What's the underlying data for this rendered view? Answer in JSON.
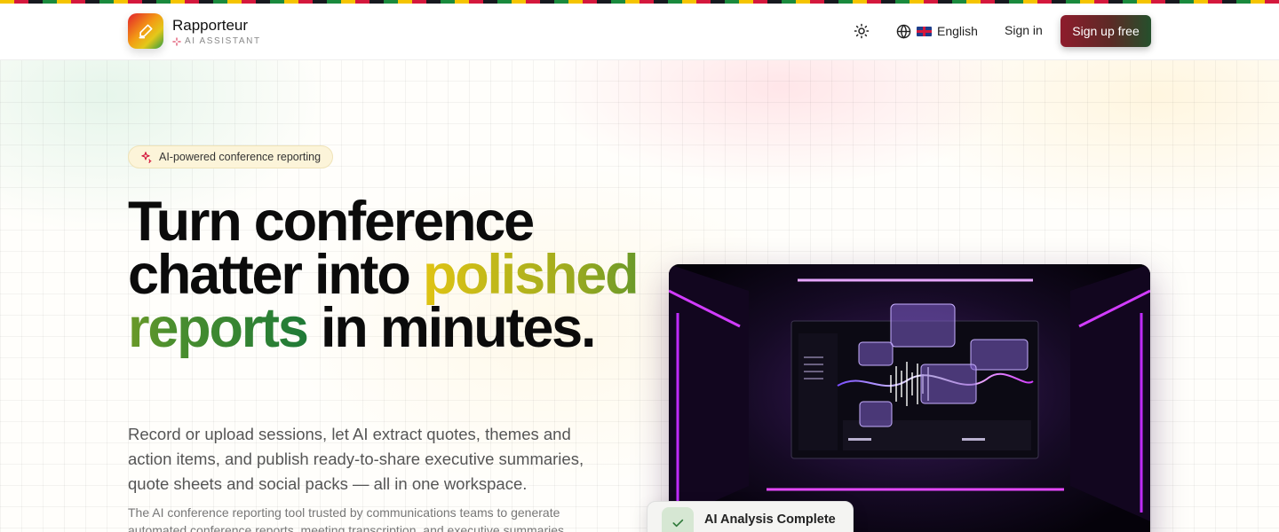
{
  "brand": {
    "name": "Rapporteur",
    "subtitle": "AI ASSISTANT",
    "logo_icon": "pen-icon"
  },
  "nav": {
    "theme_icon": "sun-icon",
    "language_icon": "globe-icon",
    "language_flag": "uk-flag-icon",
    "language_label": "English",
    "signin_label": "Sign in",
    "signup_label": "Sign up free"
  },
  "hero": {
    "pill_icon": "sparkles-icon",
    "pill_text": "AI-powered conference reporting",
    "headline_part1": "Turn conference chatter into ",
    "headline_highlight": "polished reports",
    "headline_part2": " in minutes.",
    "lead": "Record or upload sessions, let AI extract quotes, themes and action items, and publish ready-to-share executive summaries, quote sheets and social packs — all in one workspace.",
    "small_text": "The AI conference reporting tool trusted by communications teams to generate automated conference reports, meeting transcription, and executive summaries",
    "preview_image": "dashboard-preview-image",
    "badge_icon": "check-icon",
    "badge_text": "AI Analysis Complete"
  },
  "colors": {
    "accent_yellow": "#e0c414",
    "accent_green": "#1f7a37",
    "accent_red": "#8e1c2c",
    "neon_purple": "#d23cff"
  }
}
